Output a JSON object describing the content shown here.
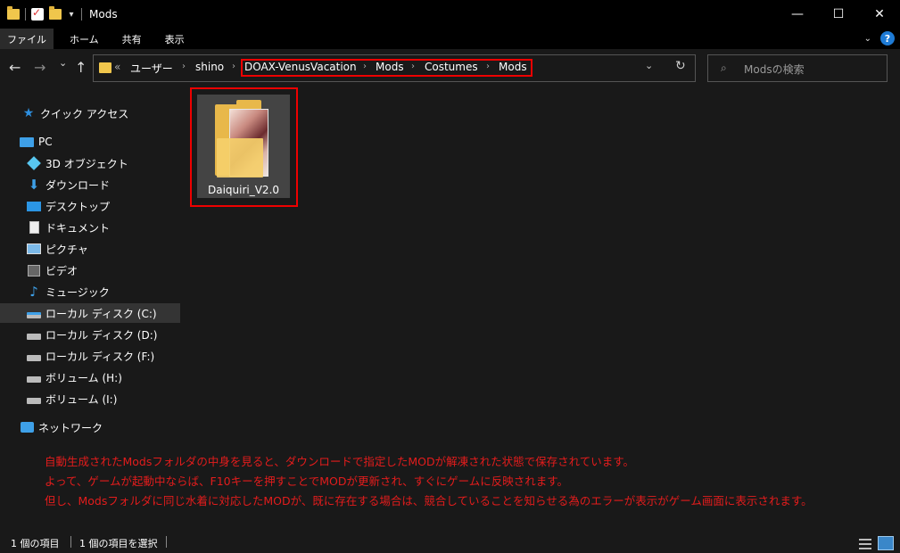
{
  "window": {
    "title": "Mods",
    "controls": {
      "minimize": "—",
      "maximize": "☐",
      "close": "✕"
    }
  },
  "ribbon": {
    "tabs": [
      "ファイル",
      "ホーム",
      "共有",
      "表示"
    ],
    "help": "?"
  },
  "nav": {
    "back": "←",
    "forward": "→",
    "recent": "⌄",
    "up": "↑"
  },
  "address": {
    "overflow": "«",
    "crumbs": [
      "ユーザー",
      "shino",
      "DOAX-VenusVacation",
      "Mods",
      "Costumes",
      "Mods"
    ],
    "separator": "›",
    "dropdown": "⌄",
    "refresh": "↻"
  },
  "search": {
    "icon": "search-icon",
    "placeholder": "Modsの検索"
  },
  "sidebar": {
    "items": [
      {
        "label": "クイック アクセス",
        "icon": "star-icon"
      },
      {
        "label": "PC",
        "icon": "pc-icon"
      },
      {
        "label": "3D オブジェクト",
        "icon": "3d-objects-icon"
      },
      {
        "label": "ダウンロード",
        "icon": "download-icon"
      },
      {
        "label": "デスクトップ",
        "icon": "desktop-icon"
      },
      {
        "label": "ドキュメント",
        "icon": "document-icon"
      },
      {
        "label": "ピクチャ",
        "icon": "pictures-icon"
      },
      {
        "label": "ビデオ",
        "icon": "video-icon"
      },
      {
        "label": "ミュージック",
        "icon": "music-icon"
      },
      {
        "label": "ローカル ディスク (C:)",
        "icon": "drive-c-icon"
      },
      {
        "label": "ローカル ディスク (D:)",
        "icon": "drive-icon"
      },
      {
        "label": "ローカル ディスク (F:)",
        "icon": "drive-icon"
      },
      {
        "label": "ボリューム (H:)",
        "icon": "drive-icon"
      },
      {
        "label": "ボリューム (I:)",
        "icon": "drive-icon"
      },
      {
        "label": "ネットワーク",
        "icon": "network-icon"
      }
    ]
  },
  "files": [
    {
      "name": "Daiquiri_V2.0",
      "icon": "folder-icon"
    }
  ],
  "notes": [
    "自動生成されたModsフォルダの中身を見ると、ダウンロードで指定したMODが解凍された状態で保存されています。",
    "よって、ゲームが起動中ならば、F10キーを押すことでMODが更新され、すぐにゲームに反映されます。",
    "但し、Modsフォルダに同じ水着に対応したMODが、既に存在する場合は、競合していることを知らせる為のエラーが表示がゲーム画面に表示されます。"
  ],
  "status": {
    "count": "1 個の項目",
    "selected": "1 個の項目を選択"
  },
  "colors": {
    "highlight": "#e31c1c",
    "accent": "#3ea0e8",
    "background": "#191919"
  }
}
